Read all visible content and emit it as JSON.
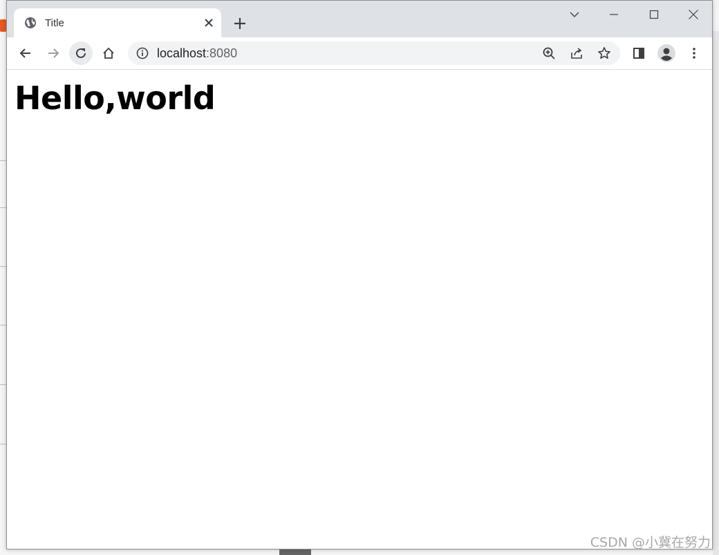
{
  "tab": {
    "title": "Title",
    "favicon": "globe-icon"
  },
  "toolbar": {
    "url_host": "localhost",
    "url_port": ":8080"
  },
  "page": {
    "heading": "Hello,world"
  },
  "watermark": "CSDN @小冀在努力",
  "colors": {
    "tabstrip": "#dee1e6",
    "omnibox": "#f1f3f4",
    "icon": "#5f6368"
  }
}
